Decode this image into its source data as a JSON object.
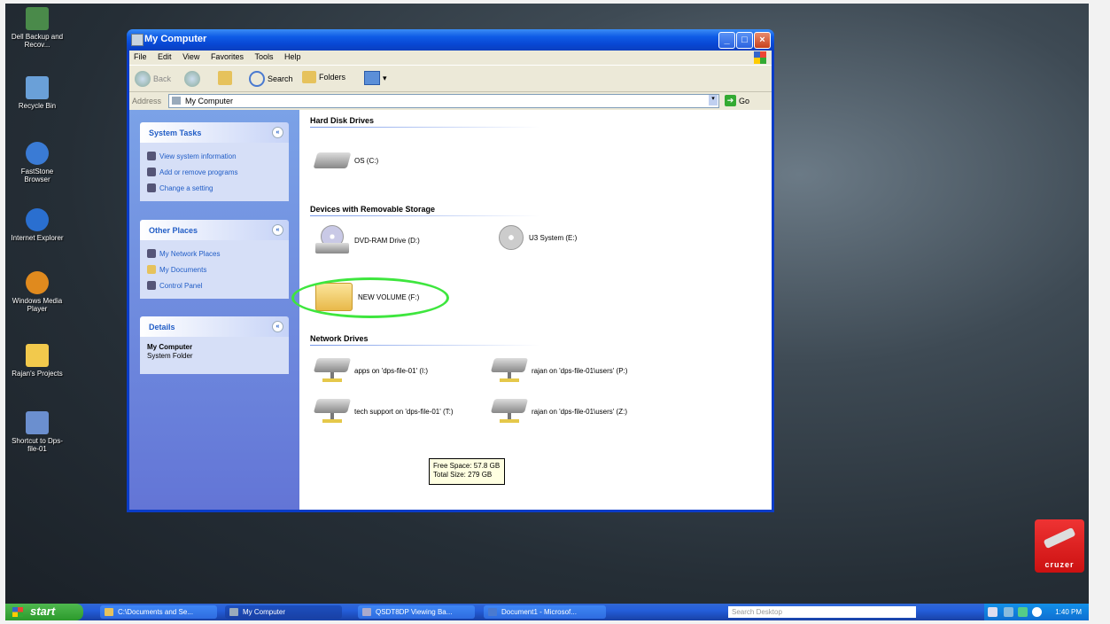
{
  "desktop": {
    "icons": [
      {
        "label": "Dell Backup and Recov...",
        "icon": "dell-backup-icon",
        "color": "#4a8a4a"
      },
      {
        "label": "Recycle Bin",
        "icon": "recycle-bin-icon",
        "color": "#6aa0d8"
      },
      {
        "label": "FastStone Browser",
        "icon": "faststone-browser-icon",
        "color": "#3a7bd5"
      },
      {
        "label": "Internet Explorer",
        "icon": "internet-explorer-icon",
        "color": "#2a6fd0"
      },
      {
        "label": "Windows Media Player",
        "icon": "windows-media-player-icon",
        "color": "#e08a1e"
      },
      {
        "label": "Rajan's Projects",
        "icon": "folder-icon",
        "color": "#f2c94c"
      },
      {
        "label": "Shortcut to Dps-file-01",
        "icon": "network-shortcut-icon",
        "color": "#6b8fcf"
      }
    ]
  },
  "window": {
    "title": "My Computer",
    "menu": [
      "File",
      "Edit",
      "View",
      "Favorites",
      "Tools",
      "Help"
    ],
    "toolbar": {
      "back": "Back",
      "search": "Search",
      "folders": "Folders"
    },
    "address": {
      "label": "Address",
      "value": "My Computer",
      "go": "Go"
    },
    "left_pane": {
      "system_tasks": {
        "title": "System Tasks",
        "items": [
          "View system information",
          "Add or remove programs",
          "Change a setting"
        ]
      },
      "other_places": {
        "title": "Other Places",
        "items": [
          "My Network Places",
          "My Documents",
          "Control Panel"
        ]
      },
      "details": {
        "title": "Details",
        "name": "My Computer",
        "type": "System Folder"
      }
    },
    "sections": {
      "hard_disk": {
        "title": "Hard Disk Drives",
        "items": [
          "OS (C:)"
        ]
      },
      "removable": {
        "title": "Devices with Removable Storage",
        "items": [
          "DVD-RAM Drive (D:)",
          "U3 System (E:)",
          "NEW VOLUME (F:)"
        ]
      },
      "network": {
        "title": "Network Drives",
        "items": [
          "apps on 'dps-file-01' (I:)",
          "rajan on 'dps-file-01\\users' (P:)",
          "tech support on 'dps-file-01' (T:)",
          "rajan on 'dps-file-01\\users' (Z:)"
        ]
      }
    },
    "tooltip": {
      "line1": "Free Space: 57.8 GB",
      "line2": "Total Size: 279 GB"
    }
  },
  "taskbar": {
    "start": "start",
    "tasks": [
      "C:\\Documents and Se...",
      "My Computer",
      "QSDT8DP Viewing Ba...",
      "Document1 - Microsof..."
    ],
    "search_placeholder": "Search Desktop",
    "clock": "1:40 PM"
  },
  "cruzer": {
    "label": "cruzer"
  },
  "colors": {
    "highlight_ellipse": "#3ee63e",
    "title_blue": "#0a3cc8",
    "task_pane": "#7ba2e7"
  }
}
